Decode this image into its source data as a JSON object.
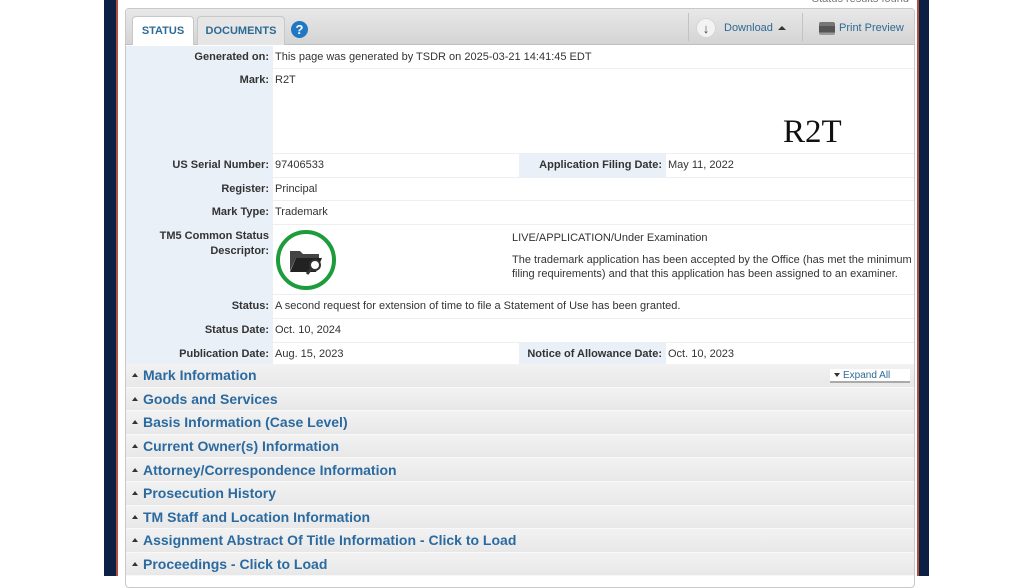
{
  "top_note": "Status results found",
  "toolbar": {
    "tabs": [
      {
        "label": "STATUS",
        "active": true
      },
      {
        "label": "DOCUMENTS",
        "active": false
      }
    ],
    "help_icon": "question-circle-icon",
    "download_label": "Download",
    "print_label": "Print Preview"
  },
  "status": {
    "generated_on_label": "Generated on:",
    "generated_on_value": "This page was generated by TSDR on 2025-03-21 14:41:45 EDT",
    "mark_label": "Mark:",
    "mark_value": "R2T",
    "mark_image_text": "R2T",
    "serial_label": "US Serial Number:",
    "serial_value": "97406533",
    "filing_date_label": "Application Filing Date:",
    "filing_date_value": "May 11, 2022",
    "register_label": "Register:",
    "register_value": "Principal",
    "mark_type_label": "Mark Type:",
    "mark_type_value": "Trademark",
    "tm5_label": "TM5 Common Status Descriptor:",
    "tm5_status": "LIVE/APPLICATION/Under Examination",
    "tm5_description": "The trademark application has been accepted by the Office (has met the minimum filing requirements) and that this application has been assigned to an examiner.",
    "status_label": "Status:",
    "status_value": "A second request for extension of time to file a Statement of Use has been granted.",
    "status_date_label": "Status Date:",
    "status_date_value": "Oct. 10, 2024",
    "publication_date_label": "Publication Date:",
    "publication_date_value": "Aug. 15, 2023",
    "noa_date_label": "Notice of Allowance Date:",
    "noa_date_value": "Oct. 10, 2023"
  },
  "expand_all_label": "Expand All",
  "sections": [
    "Mark Information",
    "Goods and Services",
    "Basis Information (Case Level)",
    "Current Owner(s) Information",
    "Attorney/Correspondence Information",
    "Prosecution History",
    "TM Staff and Location Information",
    "Assignment Abstract Of Title Information - Click to Load",
    "Proceedings - Click to Load"
  ],
  "colors": {
    "link_blue": "#2b6aa0",
    "label_bg": "#eaf0f7",
    "status_green": "#1e9b3b",
    "frame_navy": "#0c1f45"
  }
}
